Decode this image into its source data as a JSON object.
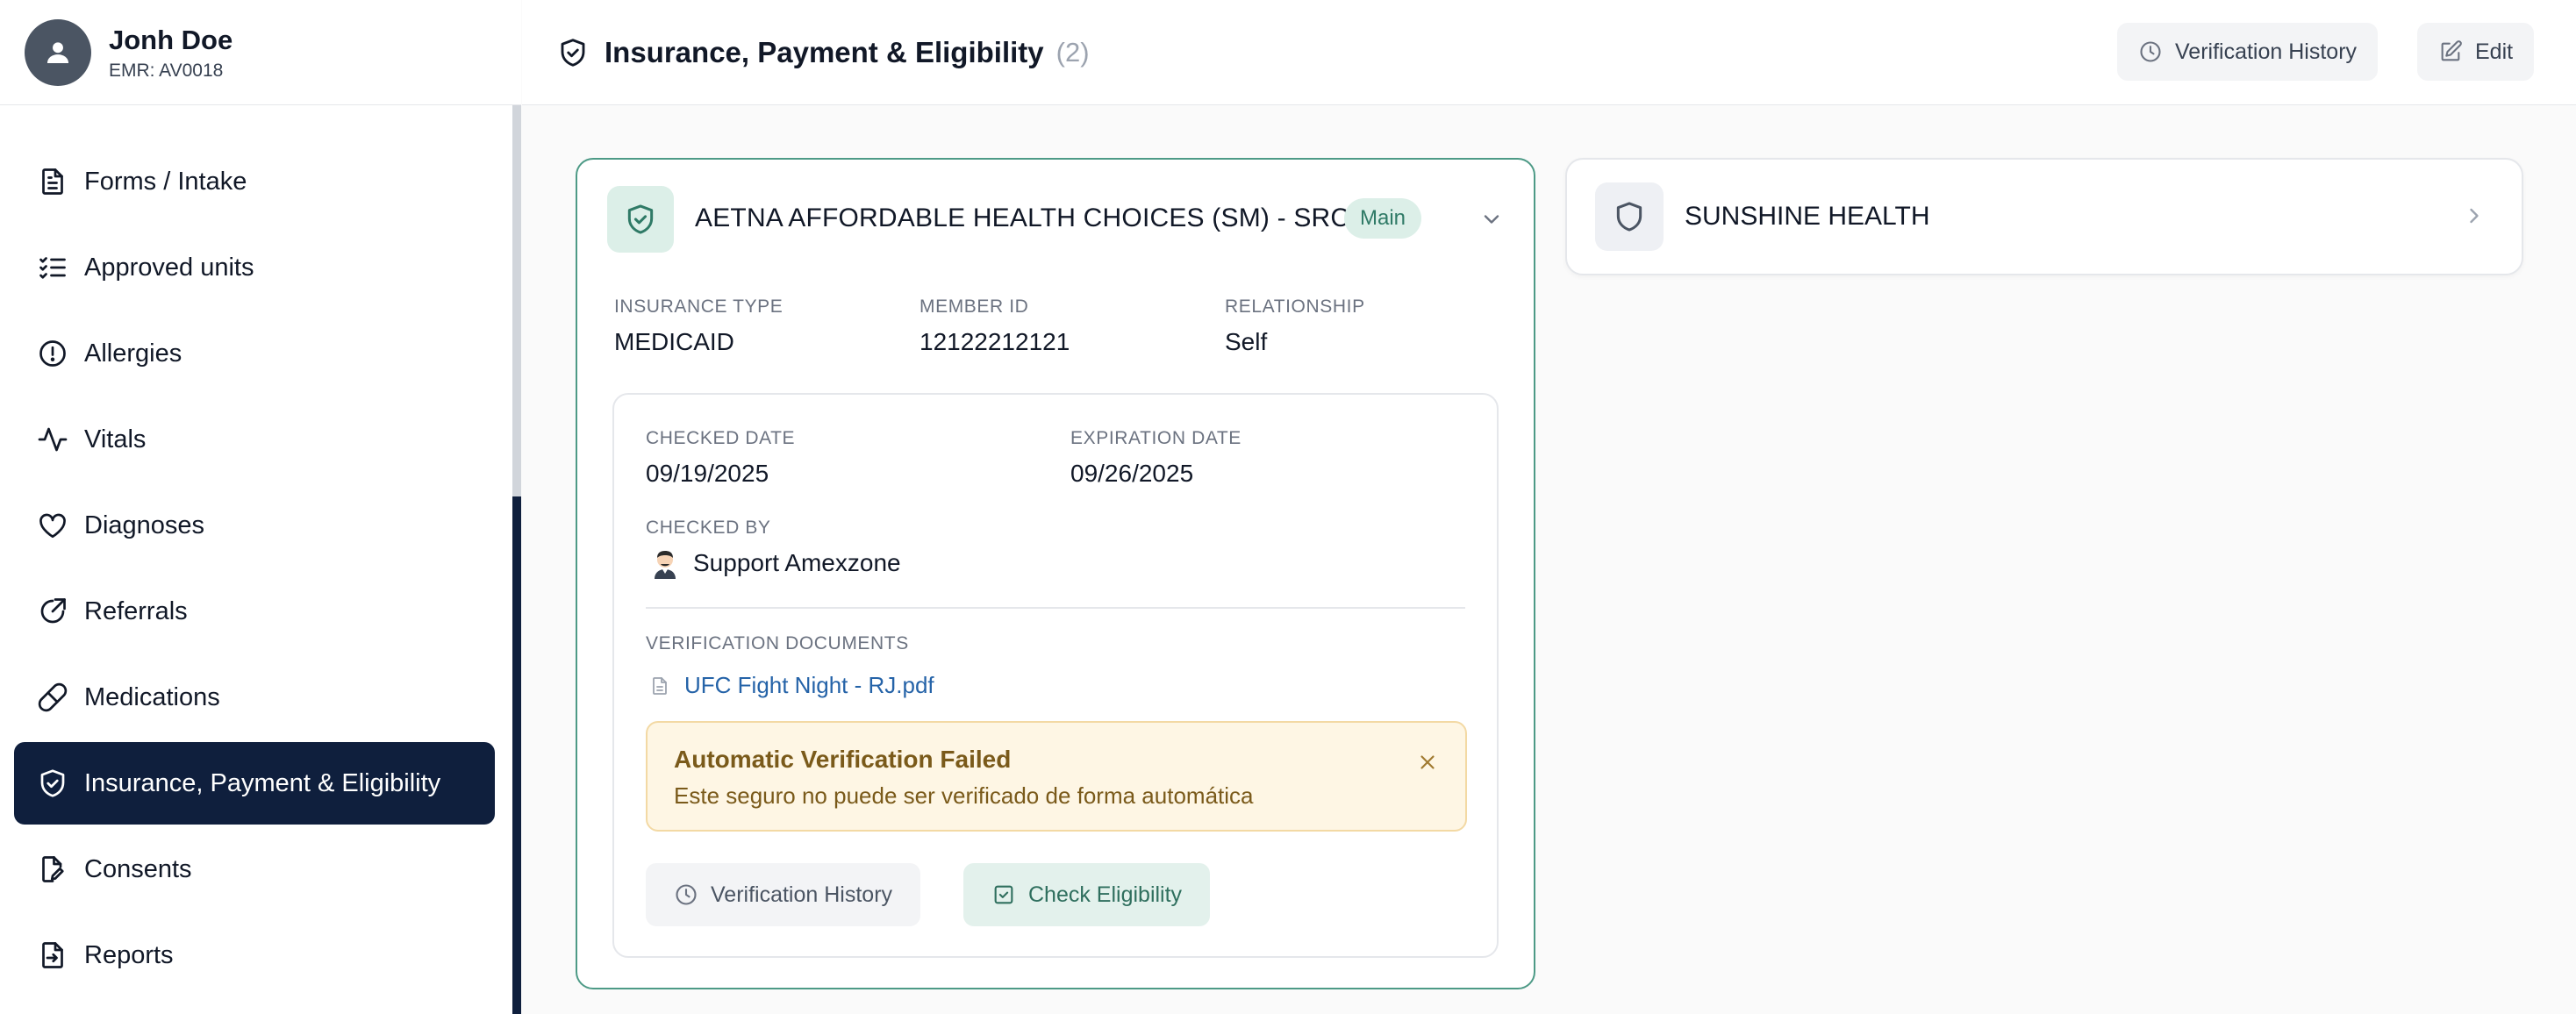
{
  "patient": {
    "name": "Jonh Doe",
    "emr": "EMR: AV0018"
  },
  "sidebar": {
    "items": [
      {
        "label": "Forms / Intake",
        "icon": "document-icon"
      },
      {
        "label": "Approved units",
        "icon": "checklist-icon"
      },
      {
        "label": "Allergies",
        "icon": "alert-circle-icon"
      },
      {
        "label": "Vitals",
        "icon": "activity-icon"
      },
      {
        "label": "Diagnoses",
        "icon": "heart-icon"
      },
      {
        "label": "Referrals",
        "icon": "external-link-icon"
      },
      {
        "label": "Medications",
        "icon": "pill-icon"
      },
      {
        "label": "Insurance, Payment & Eligibility",
        "icon": "shield-check-icon",
        "active": true
      },
      {
        "label": "Consents",
        "icon": "document-edit-icon"
      },
      {
        "label": "Reports",
        "icon": "file-export-icon"
      }
    ]
  },
  "header": {
    "title": "Insurance, Payment & Eligibility",
    "count": "(2)",
    "history_label": "Verification History",
    "edit_label": "Edit"
  },
  "main_insurance": {
    "name": "AETNA AFFORDABLE HEALTH CHOICES (SM) - SRC",
    "badge": "Main",
    "insurance_type_label": "INSURANCE TYPE",
    "insurance_type": "MEDICAID",
    "member_id_label": "MEMBER ID",
    "member_id": "12122212121",
    "relationship_label": "RELATIONSHIP",
    "relationship": "Self",
    "checked_date_label": "CHECKED DATE",
    "checked_date": "09/19/2025",
    "expiration_date_label": "EXPIRATION DATE",
    "expiration_date": "09/26/2025",
    "checked_by_label": "CHECKED BY",
    "checked_by": "Support Amexzone",
    "documents_label": "VERIFICATION DOCUMENTS",
    "document": "UFC Fight Night - RJ.pdf",
    "alert_title": "Automatic Verification Failed",
    "alert_message": "Este seguro no puede ser verificado de forma automática",
    "history_button": "Verification History",
    "eligibility_button": "Check Eligibility"
  },
  "secondary_insurance": {
    "name": "SUNSHINE HEALTH"
  },
  "colors": {
    "active_nav": "#0f1f3d",
    "accent_green": "#4d9a86",
    "alert_bg": "#fef6e4",
    "link": "#2563a8"
  }
}
